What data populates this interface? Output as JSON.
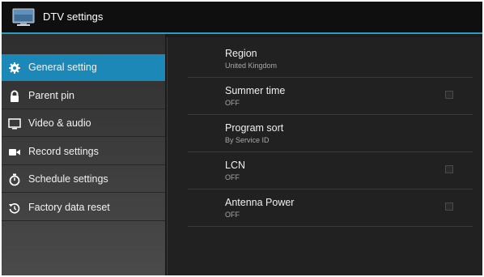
{
  "app": {
    "title": "DTV settings",
    "accent_color": "#2b9cc4"
  },
  "sidebar": {
    "items": [
      {
        "label": "General setting",
        "icon": "gear-icon",
        "active": true
      },
      {
        "label": "Parent pin",
        "icon": "lock-icon",
        "active": false
      },
      {
        "label": "Video & audio",
        "icon": "monitor-icon",
        "active": false
      },
      {
        "label": "Record settings",
        "icon": "video-camera-icon",
        "active": false
      },
      {
        "label": "Schedule settings",
        "icon": "stopwatch-icon",
        "active": false
      },
      {
        "label": "Factory data reset",
        "icon": "reset-icon",
        "active": false
      }
    ]
  },
  "settings": {
    "rows": [
      {
        "title": "Region",
        "value": "United Kingdom",
        "has_checkbox": false
      },
      {
        "title": "Summer time",
        "value": "OFF",
        "has_checkbox": true,
        "checked": false
      },
      {
        "title": "Program sort",
        "value": "By Service ID",
        "has_checkbox": false
      },
      {
        "title": "LCN",
        "value": "OFF",
        "has_checkbox": true,
        "checked": false
      },
      {
        "title": "Antenna Power",
        "value": "OFF",
        "has_checkbox": true,
        "checked": false
      }
    ]
  }
}
